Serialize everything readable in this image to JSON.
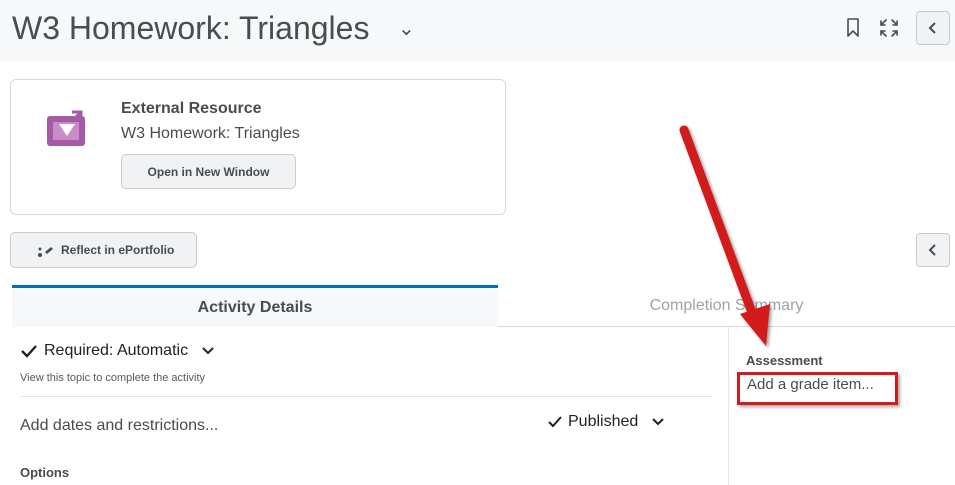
{
  "header": {
    "title": "W3 Homework: Triangles",
    "title_menu_icon": "chevron-down-icon",
    "bookmark_icon": "bookmark-icon",
    "fullscreen_icon": "fullscreen-icon",
    "collapse_icon": "chevron-left-icon"
  },
  "resource": {
    "type_label": "External Resource",
    "name": "W3 Homework: Triangles",
    "open_button": "Open in New Window",
    "icon": "external-resource-icon",
    "icon_color": "#a35ba3"
  },
  "reflect_button": "Reflect in ePortfolio",
  "tabs": [
    {
      "label": "Activity Details",
      "active": true
    },
    {
      "label": "Completion Summary",
      "active": false
    }
  ],
  "activity": {
    "required_label": "Required: Automatic",
    "required_hint": "View this topic to complete the activity",
    "dates_link": "Add dates and restrictions...",
    "published_label": "Published",
    "options_heading": "Options"
  },
  "assessment": {
    "heading": "Assessment",
    "add_grade_link": "Add a grade item..."
  },
  "colors": {
    "accent": "#006fbf",
    "annotation_red": "#d21b1b"
  }
}
